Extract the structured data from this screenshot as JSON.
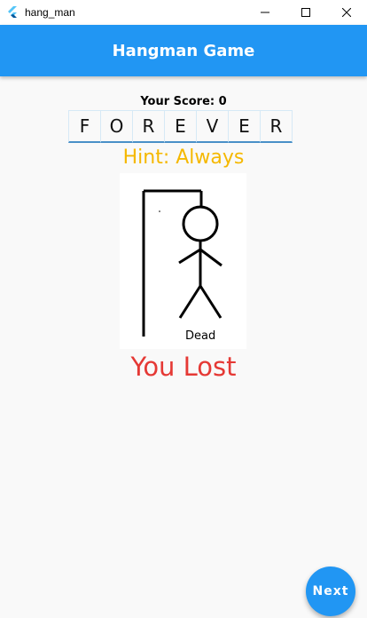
{
  "window": {
    "app_name": "hang_man",
    "controls": [
      "minimize-icon",
      "maximize-icon",
      "close-icon"
    ]
  },
  "appbar": {
    "title": "Hangman Game"
  },
  "score": {
    "label": "Your Score: 0"
  },
  "word": {
    "letters": [
      "F",
      "O",
      "R",
      "E",
      "V",
      "E",
      "R"
    ]
  },
  "hint": {
    "text": "Hint: Always"
  },
  "hangman": {
    "status": "Dead"
  },
  "result": {
    "text": "You Lost"
  },
  "fab": {
    "label": "Next"
  },
  "colors": {
    "primary": "#2196f3",
    "hint": "#f5b800",
    "lost": "#e53935",
    "background": "#f9f9f9"
  }
}
